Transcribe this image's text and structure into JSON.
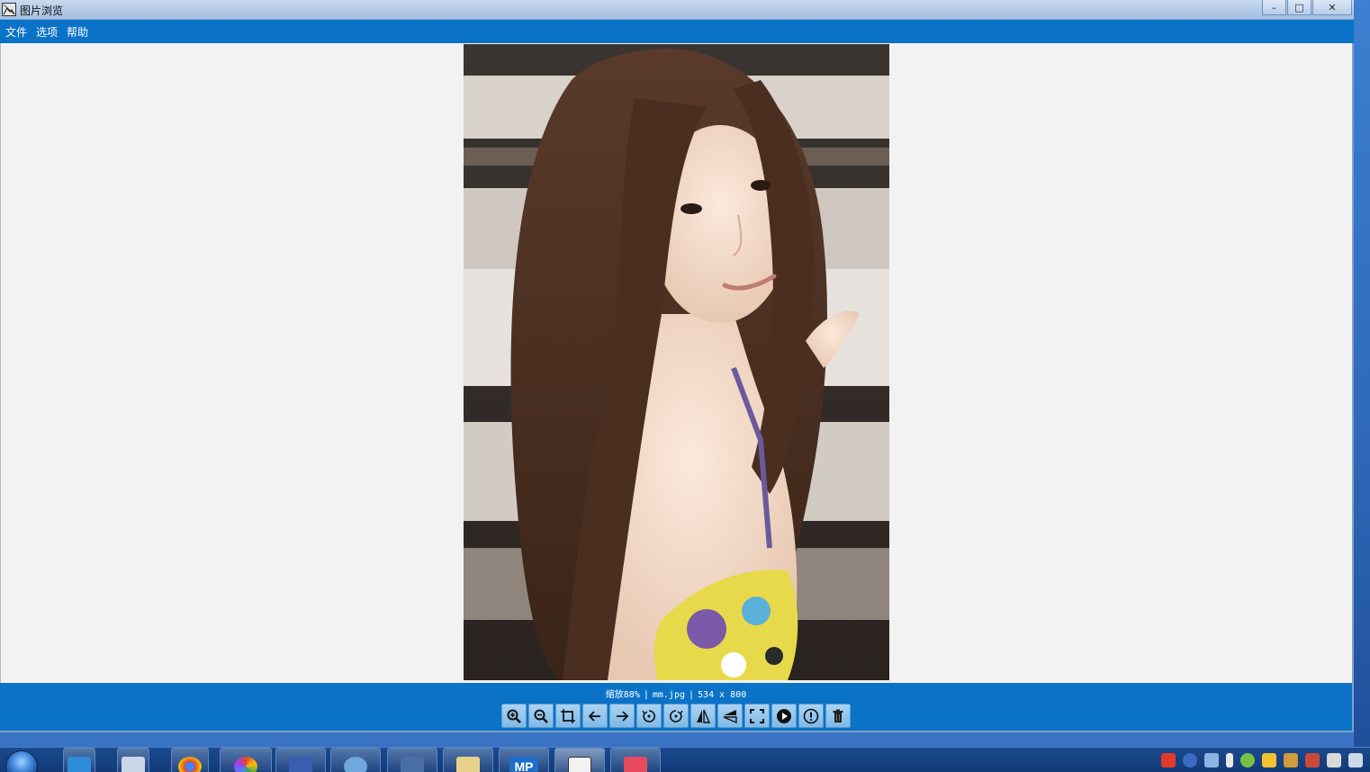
{
  "window": {
    "title": "图片浏览",
    "controls": {
      "minimize": "–",
      "maximize": "□",
      "close": "✕"
    }
  },
  "menu": {
    "items": [
      "文件",
      "选项",
      "帮助"
    ]
  },
  "status": {
    "zoom": "缩放88%",
    "filename": "mm.jpg",
    "dimensions": "534 x 800"
  },
  "toolbar": {
    "tools": [
      {
        "name": "zoom-in-icon"
      },
      {
        "name": "zoom-out-icon"
      },
      {
        "name": "fit-window-icon"
      },
      {
        "name": "previous-icon"
      },
      {
        "name": "next-icon"
      },
      {
        "name": "rotate-left-icon"
      },
      {
        "name": "rotate-right-icon"
      },
      {
        "name": "flip-horizontal-icon"
      },
      {
        "name": "flip-vertical-icon"
      },
      {
        "name": "fullscreen-icon"
      },
      {
        "name": "slideshow-play-icon"
      },
      {
        "name": "info-icon"
      },
      {
        "name": "delete-icon"
      }
    ]
  },
  "taskbar": {
    "apps": [
      {
        "name": "sogou-pinyin-icon",
        "color": "#2e8bd8"
      },
      {
        "name": "calculator-icon",
        "color": "#c8d8e8"
      },
      {
        "name": "chrome-icon",
        "color": "#e34133"
      },
      {
        "name": "color-picker-icon",
        "color": "#7ac143"
      },
      {
        "name": "network-tool-icon",
        "color": "#3a5fb0"
      },
      {
        "name": "clock-icon",
        "color": "#6fa8dc"
      },
      {
        "name": "keyboard-tool-icon",
        "color": "#4a6fa5"
      },
      {
        "name": "notepad-icon",
        "color": "#e8d28a"
      },
      {
        "name": "mp-icon",
        "color": "#1e6ec8",
        "label": "MP"
      },
      {
        "name": "image-viewer-icon",
        "color": "#f2f2f2"
      },
      {
        "name": "camera-icon",
        "color": "#e84a5f"
      }
    ]
  },
  "colors": {
    "accent": "#0a73c7",
    "canvas": "#f2f2f2"
  }
}
